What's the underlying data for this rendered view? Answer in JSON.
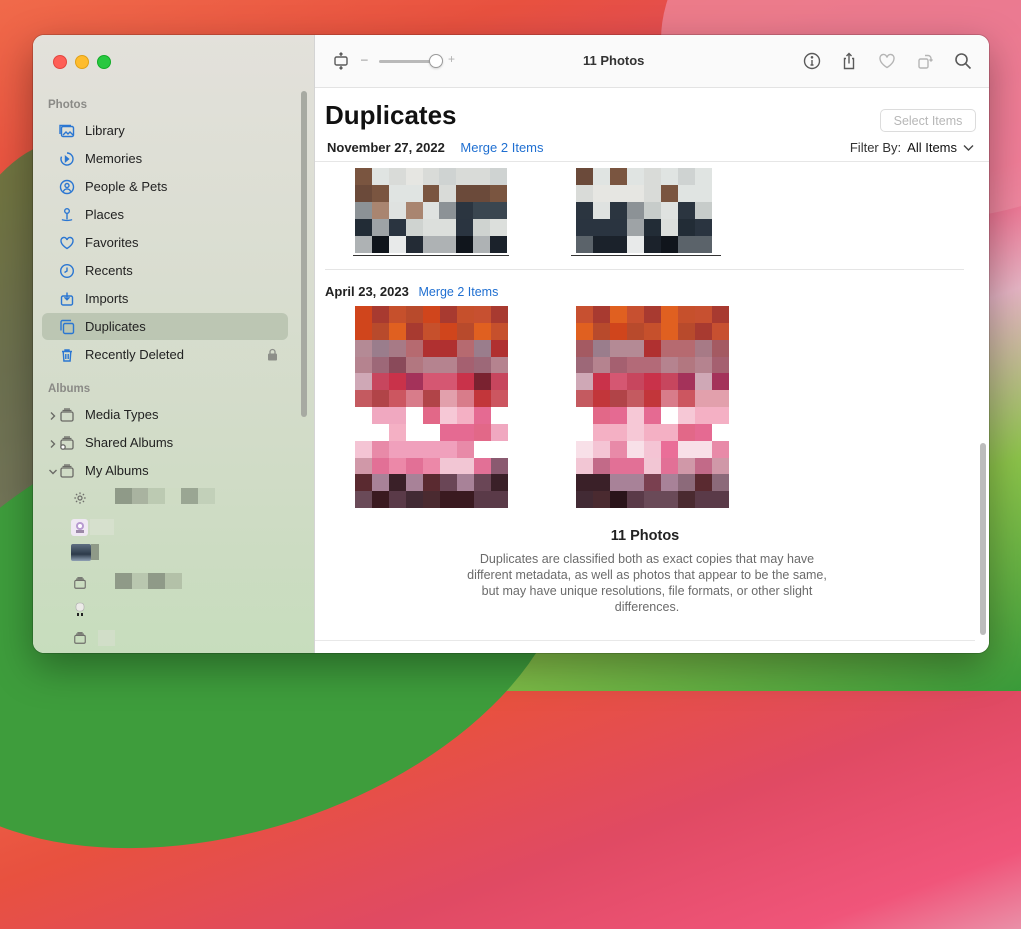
{
  "toolbar": {
    "title": "11 Photos",
    "slider_minus": "–",
    "slider_plus": "+"
  },
  "sidebar": {
    "photos_header": "Photos",
    "items": [
      {
        "label": "Library",
        "icon": "library-icon"
      },
      {
        "label": "Memories",
        "icon": "memories-icon"
      },
      {
        "label": "People & Pets",
        "icon": "people-icon"
      },
      {
        "label": "Places",
        "icon": "places-icon"
      },
      {
        "label": "Favorites",
        "icon": "heart-icon"
      },
      {
        "label": "Recents",
        "icon": "clock-icon"
      },
      {
        "label": "Imports",
        "icon": "import-icon"
      },
      {
        "label": "Duplicates",
        "icon": "duplicates-icon",
        "selected": true
      },
      {
        "label": "Recently Deleted",
        "icon": "trash-icon",
        "locked": true
      }
    ],
    "albums_header": "Albums",
    "albums": [
      {
        "label": "Media Types",
        "expanded": false
      },
      {
        "label": "Shared Albums",
        "expanded": false
      },
      {
        "label": "My Albums",
        "expanded": true
      }
    ]
  },
  "main": {
    "title": "Duplicates",
    "select_button": "Select Items",
    "filter_label": "Filter By:",
    "filter_value": "All Items",
    "groups": [
      {
        "date": "November 27, 2022",
        "merge": "Merge 2 Items"
      },
      {
        "date": "April 23, 2023",
        "merge": "Merge 2 Items"
      }
    ],
    "footer_title": "11 Photos",
    "footer_desc": "Duplicates are classified both as exact copies that may have different metadata, as well as photos that appear to be the same, but may have unique resolutions, file formats, or other slight differences."
  },
  "colors": {
    "accent": "#1f6fd1",
    "sidebar_icon": "#2a76d2"
  }
}
